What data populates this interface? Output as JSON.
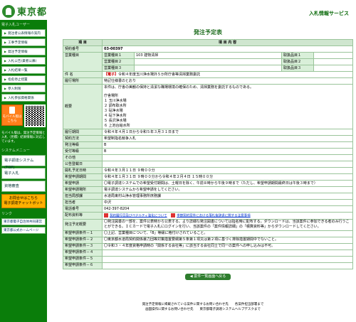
{
  "header": {
    "logo_text": "東京都",
    "service_title": "入札情報サービス"
  },
  "sidebar": {
    "section1": "電子入札ユーザー",
    "items": [
      "発注者公表情報の案内",
      "工事予定情報",
      "発注予定情報",
      "入札公告(業者公募)",
      "入札結果一覧",
      "指名停止措置",
      "参入制限",
      "入札参加資格関係"
    ],
    "mobile_label": "モバイル版はこちら",
    "mobile_note": "モバイル版は、発注予定情報と入札（見積）結果情報に対応しています。",
    "section2": "システムメニュー",
    "big_items": [
      "電子調達システム(TOP)",
      "電子入札",
      "資格審査"
    ],
    "orange_btn": "お問合せはこちら",
    "orange_sub": "電子調達チャットボット",
    "section3": "リンク",
    "links": [
      "東京都電子自治体共同運営",
      "東京都公式ホームページ"
    ]
  },
  "main": {
    "page_title": "発注予定表",
    "col_item": "項 目",
    "col_content": "項 目 内 容",
    "contract_no_label": "契約番号",
    "contract_no": "03-00397",
    "business_type_label": "営業種目",
    "biz_sub1": "営業種目１",
    "biz_sub1_value": "103 建物清掃",
    "biz_sub2": "営業種目２",
    "biz_sub3": "営業種目３",
    "biz_right1": "取扱品目１",
    "biz_right2": "取扱品目２",
    "biz_right3": "取扱品目３",
    "name_label": "件 名",
    "name_tag": "【電子】",
    "name_value": "令和４年度玉川浄水場外５か所庁舎等清掃業務委託",
    "location_label": "履行場所",
    "location_value": "特記仕様書のとおり",
    "summary_label": "概要",
    "summary_intro": "本件は、庁舎の美観の保持と清潔な職場環境の確保のため、清掃業務を委託するものである。",
    "summary_list": [
      "庁舎場所",
      "１ 玉川浄水場",
      "２ 調布取水所",
      "３ 砧浄水場",
      "４ 砧下浄水所",
      "５ 長沢浄水場",
      "６ 上池台給水所"
    ],
    "period_label": "履行期間",
    "period_value": "令和４年４月１日から令和５年３月３１日まで",
    "method_label": "契約方法",
    "method_value": "希望制指名競争入札",
    "order_label": "発注等級",
    "order_value": "B",
    "receive_label": "受付等級",
    "receive_value": "B",
    "other_label": "その他",
    "publish_label": "公告登載日",
    "open_label": "開札予定日時",
    "open_value": "令和４年３月１１日 ９時００分",
    "apply_period_label": "希望申請期間",
    "apply_period_value": "令和４年１月３１日 ９時００分から令和４年２月４日 １５時００分",
    "apply_method_label": "希望申請",
    "apply_method_value": "〇電子調達システムでの希望受付期間は、土曜日を除く、午前８時から午後９時まで（ただし、希望申請期間最終日は午後３時まで）",
    "apply_sys_label": "希望申請場所",
    "apply_sys_value": "電子調達システムから希望申請をしてください。",
    "dept_label": "担当局部課",
    "dept_value": "水道局東村山浄水管理事務所庶務課",
    "person_label": "担当者",
    "person_value": "中沢",
    "tel_label": "電話番号",
    "tel_value": "042-397-8204",
    "docs_label": "配布資料等",
    "doc1": "契約履行日及びペナルティ強化について",
    "doc2": "季節契約案件における落札後辞退に関する注意事項",
    "dist_label": "発注予定概要",
    "dist_value": "〇発注図書の一部を、案件公表時から公表する。より詳細な発注図書については指名時に配布する。ダウンロードは、当該案件に参加できる者のみ行うことができる。ＩＣカードで電子入札にログインを行い、当該案件の「案件情報詳細」の「積算資料等」からダウンロードしてください。",
    "req1_label": "希望申請条件－１",
    "req1_value": "〇上記、営業種目について、「B」等級に格付けされていること。",
    "req2_label": "希望申請条件－２",
    "req2_value": "〇東京都水道局契約関係暴力団等対策措置要綱第５条第１項又は第２項に基づく排除措置期間中でないこと。",
    "req3_label": "希望申請条件－３",
    "req3_value": "〇令和３・４年度資格申請時の「関係する会社等」に該当する会社同士で同一の案件への申し込みは不可。",
    "req4_label": "希望申請条件－４",
    "req5_label": "希望申請条件－５",
    "req6_label": "希望申請条件－６",
    "back_button": "◀ 案件一覧画面へ戻る"
  },
  "footer": {
    "line1": "発注予定情報に掲載されている案件に関するお問い合わせ先　　各案件担当部署まで",
    "line2": "画面操作に関するお問い合わせ先　　東京都電子調達システムヘルプデスクまで"
  }
}
